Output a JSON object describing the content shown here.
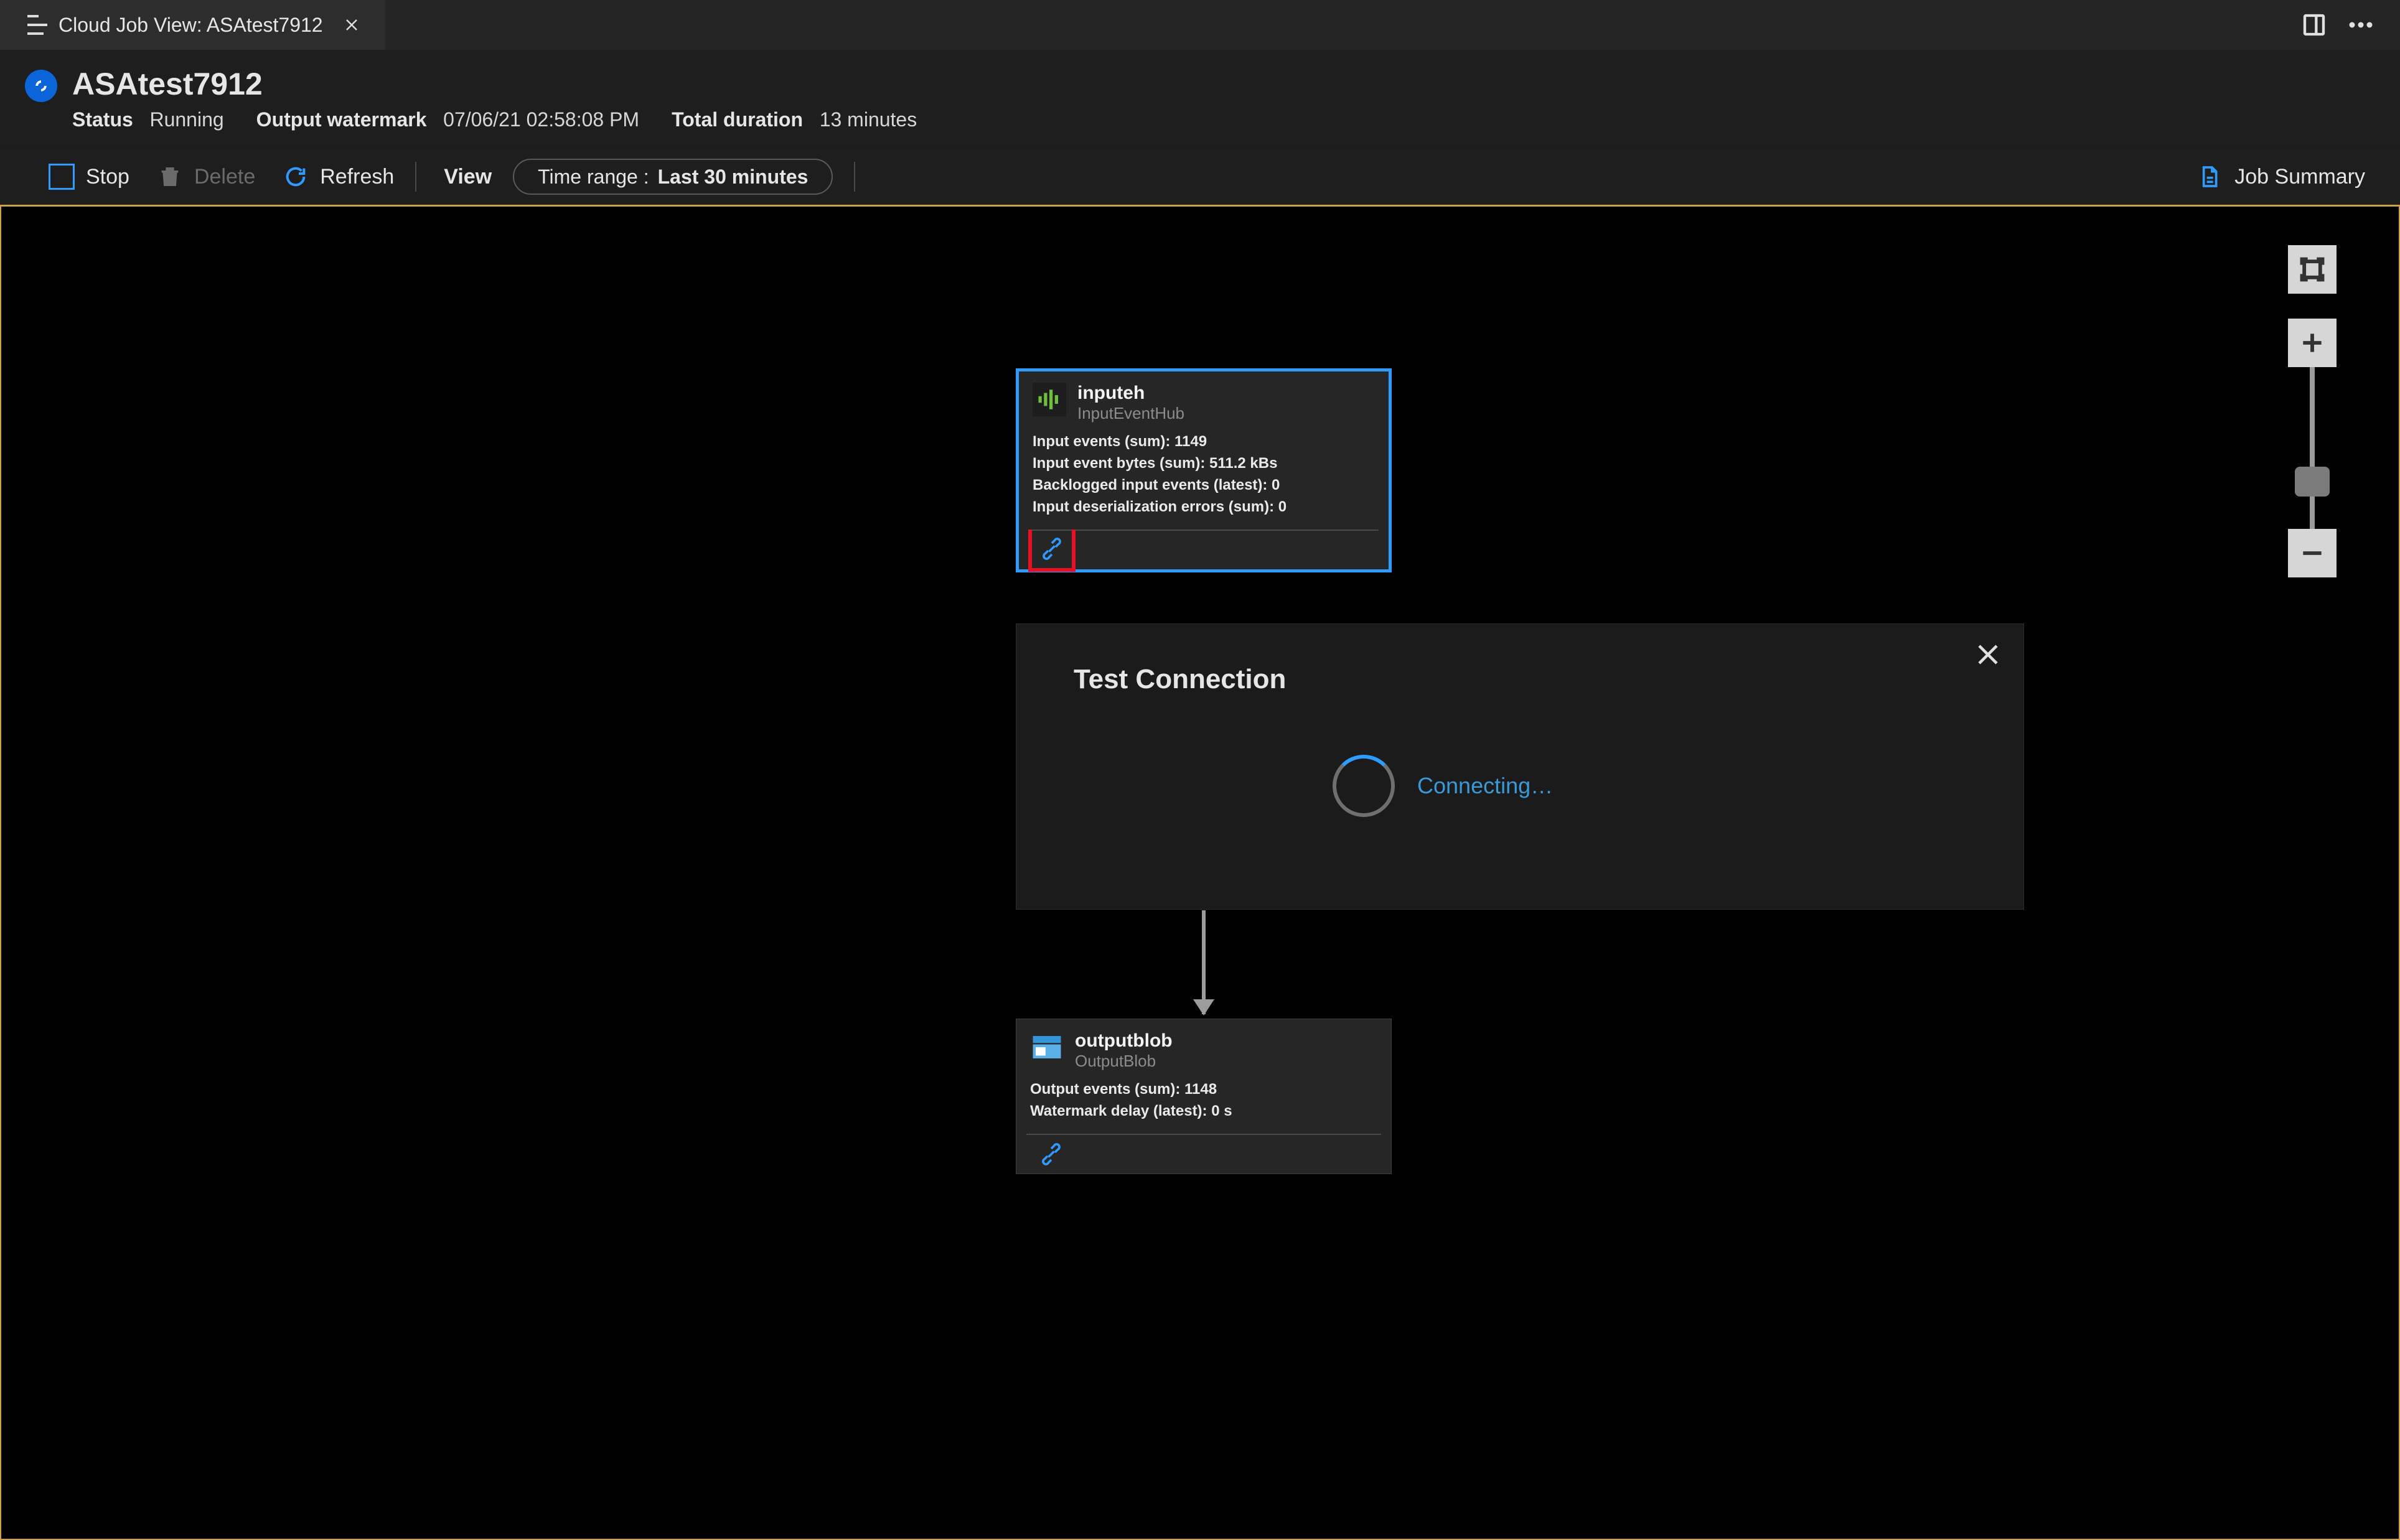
{
  "tab": {
    "prefix": "Cloud Job View:",
    "name": "ASAtest7912"
  },
  "header": {
    "title": "ASAtest7912",
    "status_label": "Status",
    "status_value": "Running",
    "watermark_label": "Output watermark",
    "watermark_value": "07/06/21 02:58:08 PM",
    "duration_label": "Total duration",
    "duration_value": "13 minutes"
  },
  "toolbar": {
    "stop": "Stop",
    "delete": "Delete",
    "refresh": "Refresh",
    "view": "View",
    "time_label": "Time range :",
    "time_value": "Last 30 minutes",
    "job_summary": "Job Summary"
  },
  "input_node": {
    "title": "inputeh",
    "subtitle": "InputEventHub",
    "metrics": [
      "Input events (sum): 1149",
      "Input event bytes (sum): 511.2 kBs",
      "Backlogged input events (latest): 0",
      "Input deserialization errors (sum): 0"
    ]
  },
  "output_node": {
    "title": "outputblob",
    "subtitle": "OutputBlob",
    "metrics": [
      "Output events (sum): 1148",
      "Watermark delay (latest): 0 s"
    ]
  },
  "dialog": {
    "title": "Test Connection",
    "status": "Connecting…"
  }
}
